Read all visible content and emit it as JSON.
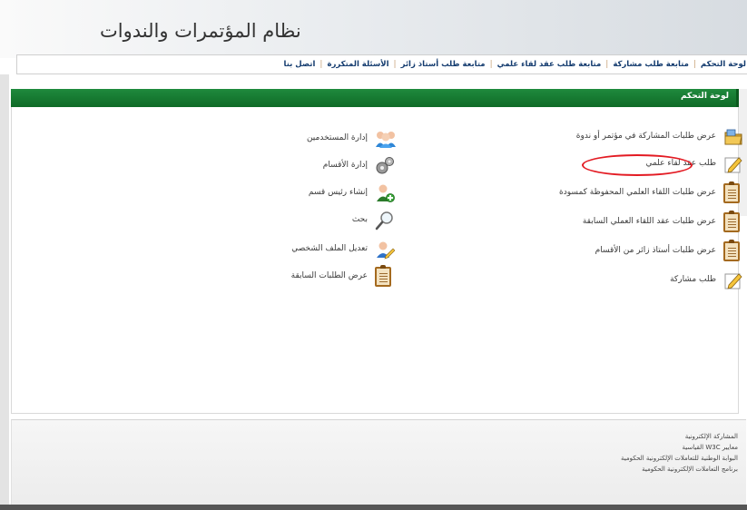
{
  "header": {
    "title": "نظام المؤتمرات والندوات"
  },
  "nav": [
    {
      "label": "لوحة التحكم"
    },
    {
      "label": "متابعة طلب مشاركة"
    },
    {
      "label": "متابعة طلب عقد لقاء علمي"
    },
    {
      "label": "متابعة طلب أستاذ زائر"
    },
    {
      "label": "الأسئلة المتكررة"
    },
    {
      "label": "اتصل بنا"
    }
  ],
  "panel": {
    "title": "لوحة التحكم"
  },
  "right_items": [
    {
      "label": "عرض طلبات المشاركة في مؤتمر أو ندوة",
      "icon": "folder-icon"
    },
    {
      "label": "طلب عقد لقاء علمي",
      "icon": "pencil-icon"
    },
    {
      "label": "عرض طلبات اللقاء العلمي المحفوظة كمسودة",
      "icon": "clipboard-icon"
    },
    {
      "label": "عرض طلبات عقد اللقاء العملي السابقة",
      "icon": "clipboard-icon"
    },
    {
      "label": "عرض طلبات أستاذ زائر من الأقسام",
      "icon": "clipboard-icon"
    },
    {
      "label": "طلب مشاركة",
      "icon": "pencil-icon"
    }
  ],
  "left_items": [
    {
      "label": "إدارة المستخدمين",
      "icon": "users-icon"
    },
    {
      "label": "إدارة الأقسام",
      "icon": "gears-icon"
    },
    {
      "label": "إنشاء رئيس قسم",
      "icon": "add-user-icon"
    },
    {
      "label": "بحث",
      "icon": "magnifier-icon"
    },
    {
      "label": "تعديل الملف الشخصي",
      "icon": "edit-profile-icon"
    },
    {
      "label": "عرض الطلبات السابقة",
      "icon": "clipboard-icon"
    }
  ],
  "footer": {
    "links": [
      "المشاركة الإلكترونية",
      "معايير W3C القياسية",
      "البوابة الوطنية للتعاملات الإلكترونية الحكومية",
      "برنامج التعاملات الإلكترونية الحكومية"
    ]
  },
  "colors": {
    "panel_green": "#127330",
    "highlight_red": "#e31b23",
    "nav_text": "#123a6e"
  }
}
